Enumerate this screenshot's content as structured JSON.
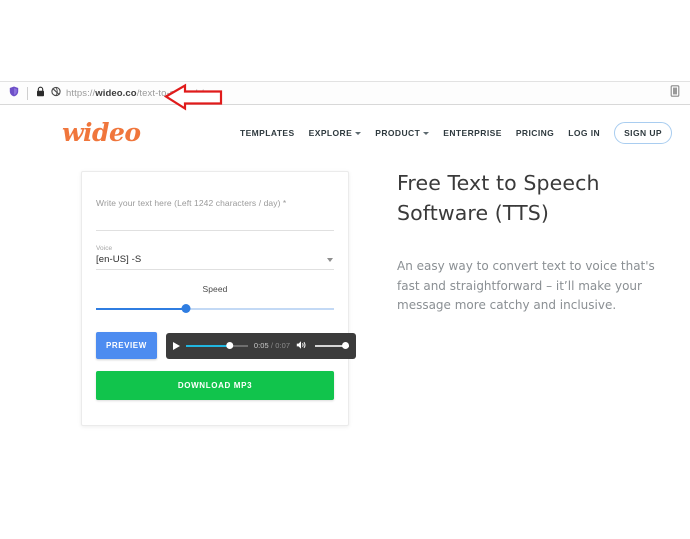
{
  "browser": {
    "url_prefix": "https://",
    "url_host": "wideo.co",
    "url_path": "/text-to-speech/",
    "icons": {
      "shield": "shield-icon",
      "lock": "lock-icon",
      "privacy": "privacy-tracker-icon",
      "reader": "reader-view-icon"
    },
    "annotation": "red-left-arrow"
  },
  "header": {
    "logo": "wideo",
    "nav": [
      {
        "label": "TEMPLATES",
        "has_caret": false
      },
      {
        "label": "EXPLORE",
        "has_caret": true
      },
      {
        "label": "PRODUCT",
        "has_caret": true
      },
      {
        "label": "ENTERPRISE",
        "has_caret": false
      },
      {
        "label": "PRICING",
        "has_caret": false
      },
      {
        "label": "LOG IN",
        "has_caret": false
      }
    ],
    "signup_label": "SIGN UP"
  },
  "form": {
    "text_placeholder": "Write your text here (Left 1242 characters / day) *",
    "text_value": "",
    "voice_label": "Voice",
    "voice_value": "[en-US] -S",
    "speed_label": "Speed",
    "speed_percent": 38,
    "preview_label": "PREVIEW",
    "download_label": "DOWNLOAD MP3"
  },
  "player": {
    "current_time": "0:05",
    "separator": "/",
    "total_time": "0:07",
    "progress_percent": 71,
    "volume_percent": 100,
    "play_icon": "play-icon",
    "volume_icon": "speaker-icon"
  },
  "hero": {
    "title_line1": "Free Text to Speech",
    "title_line2": "Software (TTS)",
    "body": "An easy way to convert text to voice that's fast and straightforward – it’ll make your message more catchy and inclusive."
  },
  "colors": {
    "brand_orange": "#f0763c",
    "accent_blue": "#4d8cf0",
    "download_green": "#11c44c",
    "player_dark": "#3b3b3b",
    "annotation_red": "#e01b1b"
  }
}
